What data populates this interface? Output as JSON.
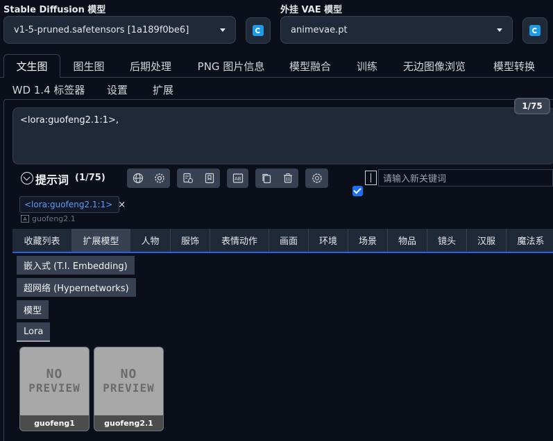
{
  "model_selectors": {
    "checkpoint": {
      "label": "Stable Diffusion 模型",
      "value": "v1-5-pruned.safetensors [1a189f0be6]"
    },
    "vae": {
      "label": "外挂 VAE 模型",
      "value": "animevae.pt"
    }
  },
  "main_tabs": [
    {
      "label": "文生图",
      "active": true
    },
    {
      "label": "图生图"
    },
    {
      "label": "后期处理"
    },
    {
      "label": "PNG 图片信息"
    },
    {
      "label": "模型融合"
    },
    {
      "label": "训练"
    },
    {
      "label": "无边图像浏览"
    },
    {
      "label": "模型转换"
    },
    {
      "label": "WD 1.4 标签器"
    },
    {
      "label": "设置"
    },
    {
      "label": "扩展"
    }
  ],
  "prompt": {
    "text": "<lora:guofeng2.1:1>,",
    "token_counter": "1/75"
  },
  "tag_helper": {
    "title": "提示词",
    "count": "(1/75)",
    "search_placeholder": "请输入新关键词",
    "tag": {
      "text": "<lora:guofeng2.1:1>",
      "close": "×",
      "sub": "guofeng2.1"
    }
  },
  "category_tabs": [
    {
      "label": "收藏列表"
    },
    {
      "label": "扩展模型",
      "active": true
    },
    {
      "label": "人物"
    },
    {
      "label": "服饰"
    },
    {
      "label": "表情动作"
    },
    {
      "label": "画面"
    },
    {
      "label": "环境"
    },
    {
      "label": "场景"
    },
    {
      "label": "物品"
    },
    {
      "label": "镜头"
    },
    {
      "label": "汉服"
    },
    {
      "label": "魔法系"
    }
  ],
  "sub_buttons": [
    {
      "label": "嵌入式 (T.I. Embedding)"
    },
    {
      "label": "超网络 (Hypernetworks)"
    },
    {
      "label": "模型"
    },
    {
      "label": "Lora",
      "active": true
    }
  ],
  "cards": [
    {
      "name": "guofeng1",
      "placeholder_line1": "NO",
      "placeholder_line2": "PREVIEW"
    },
    {
      "name": "guofeng2.1",
      "placeholder_line1": "NO",
      "placeholder_line2": "PREVIEW"
    }
  ],
  "colors": {
    "accent": "#1e6ff2",
    "background": "#0b0f19",
    "tag_link": "#5f9cf5"
  }
}
